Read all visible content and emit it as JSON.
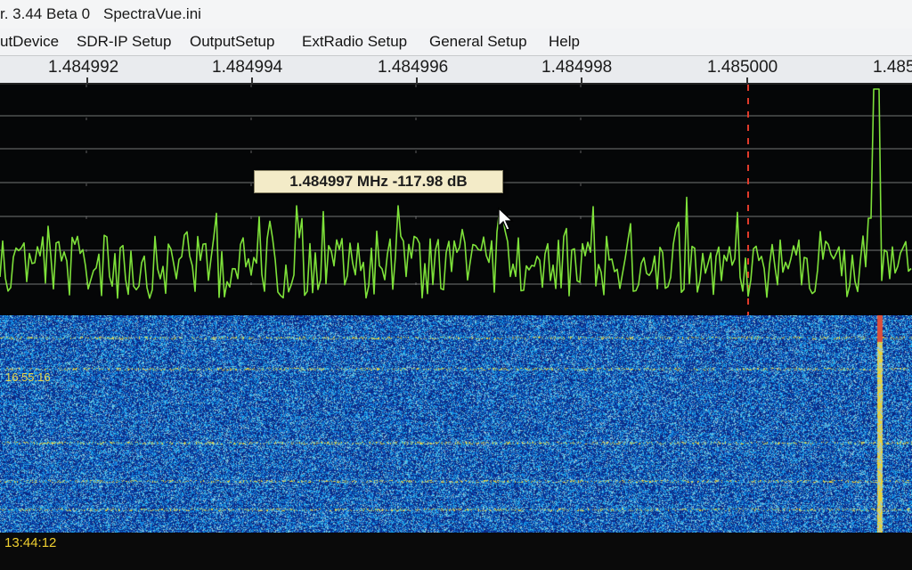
{
  "title_bar": {
    "version": "r. 3.44 Beta 0",
    "file": "SpectraVue.ini"
  },
  "menu": {
    "items": [
      "utDevice",
      "SDR-IP Setup",
      "OutputSetup",
      "ExtRadio Setup",
      "General Setup",
      "Help"
    ]
  },
  "frequency_axis": {
    "unit": "MHz",
    "labels": [
      "1.484992",
      "1.484994",
      "1.484996",
      "1.484998",
      "1.485000",
      "1.485"
    ]
  },
  "spectrum": {
    "trace_color": "#7ee13a",
    "grid_color": "#9a9a9a",
    "marker_color": "#e03a2a",
    "marker_frequency": "1.485000",
    "peak_frequency_mhz": 1.4850015,
    "cursor_readout": "1.484997 MHz -117.98 dB"
  },
  "waterfall": {
    "base_color": "#1b3fb0",
    "timestamps": [
      "16:55:16"
    ],
    "bottom_time": "13:44:12"
  }
}
